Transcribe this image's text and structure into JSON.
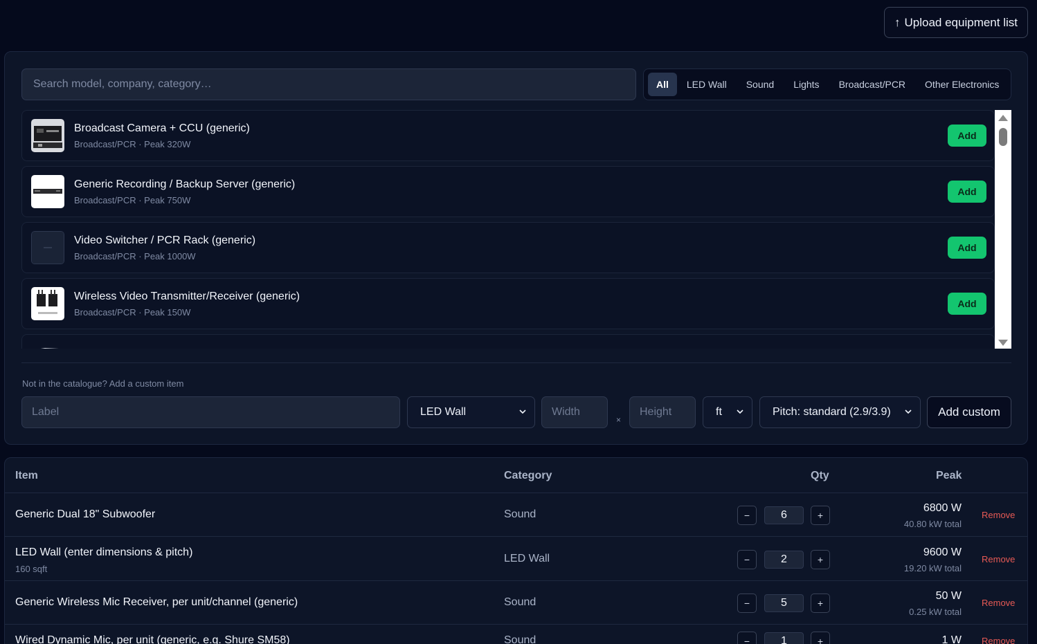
{
  "header": {
    "upload_label": "Upload equipment list",
    "upload_icon": "↑"
  },
  "catalog": {
    "search_placeholder": "Search model, company, category…",
    "filters": [
      "All",
      "LED Wall",
      "Sound",
      "Lights",
      "Broadcast/PCR",
      "Other Electronics"
    ],
    "active_filter": "All",
    "add_label": "Add",
    "items": [
      {
        "title": "Broadcast Camera + CCU (generic)",
        "sub": "Broadcast/PCR · Peak 320W",
        "thumb": "camera-thumb"
      },
      {
        "title": "Generic Recording / Backup Server (generic)",
        "sub": "Broadcast/PCR · Peak 750W",
        "thumb": "server-thumb"
      },
      {
        "title": "Video Switcher / PCR Rack (generic)",
        "sub": "Broadcast/PCR · Peak 1000W",
        "thumb": "placeholder-thumb"
      },
      {
        "title": "Wireless Video Transmitter/Receiver (generic)",
        "sub": "Broadcast/PCR · Peak 150W",
        "thumb": "transmitter-thumb"
      }
    ]
  },
  "custom": {
    "hint": "Not in the catalogue? Add a custom item",
    "label_placeholder": "Label",
    "category_value": "LED Wall",
    "width_placeholder": "Width",
    "times": "×",
    "height_placeholder": "Height",
    "unit_value": "ft",
    "pitch_value": "Pitch: standard (2.9/3.9)",
    "add_custom_label": "Add custom"
  },
  "table": {
    "headers": {
      "item": "Item",
      "category": "Category",
      "qty": "Qty",
      "peak": "Peak"
    },
    "minus": "−",
    "plus": "+",
    "remove_label": "Remove",
    "rows": [
      {
        "name": "Generic Dual 18\" Subwoofer",
        "note": "",
        "category": "Sound",
        "qty": "6",
        "peak": "6800 W",
        "total": "40.80 kW total"
      },
      {
        "name": "LED Wall (enter dimensions & pitch)",
        "note": "160 sqft",
        "category": "LED Wall",
        "qty": "2",
        "peak": "9600 W",
        "total": "19.20 kW total"
      },
      {
        "name": "Generic Wireless Mic Receiver, per unit/channel (generic)",
        "note": "",
        "category": "Sound",
        "qty": "5",
        "peak": "50 W",
        "total": "0.25 kW total"
      },
      {
        "name": "Wired Dynamic Mic, per unit (generic, e.g. Shure SM58)",
        "note": "",
        "category": "Sound",
        "qty": "1",
        "peak": "1 W",
        "total": ""
      }
    ]
  }
}
